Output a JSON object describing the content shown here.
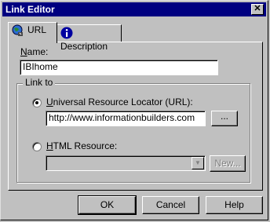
{
  "window": {
    "title": "Link Editor",
    "close_glyph": "✕"
  },
  "tabs": [
    {
      "label": "URL",
      "icon": "globe-link-icon",
      "selected": true
    },
    {
      "label": "Description",
      "icon": "info-icon",
      "selected": false
    }
  ],
  "name": {
    "label_prefix": "",
    "label_underlined": "N",
    "label_rest": "ame:",
    "value": "IBIhome"
  },
  "link_to": {
    "title": "Link to",
    "url_option": {
      "underlined": "U",
      "rest": "niversal Resource Locator (URL):",
      "selected": true,
      "value": "http://www.informationbuilders.com",
      "browse_label": "..."
    },
    "html_option": {
      "underlined": "H",
      "rest": "TML Resource:",
      "selected": false,
      "value": "",
      "new_label": "New..."
    }
  },
  "buttons": {
    "ok": "OK",
    "cancel": "Cancel",
    "help": "Help"
  },
  "colors": {
    "titlebar": "#000080",
    "face": "#c0c0c0"
  }
}
